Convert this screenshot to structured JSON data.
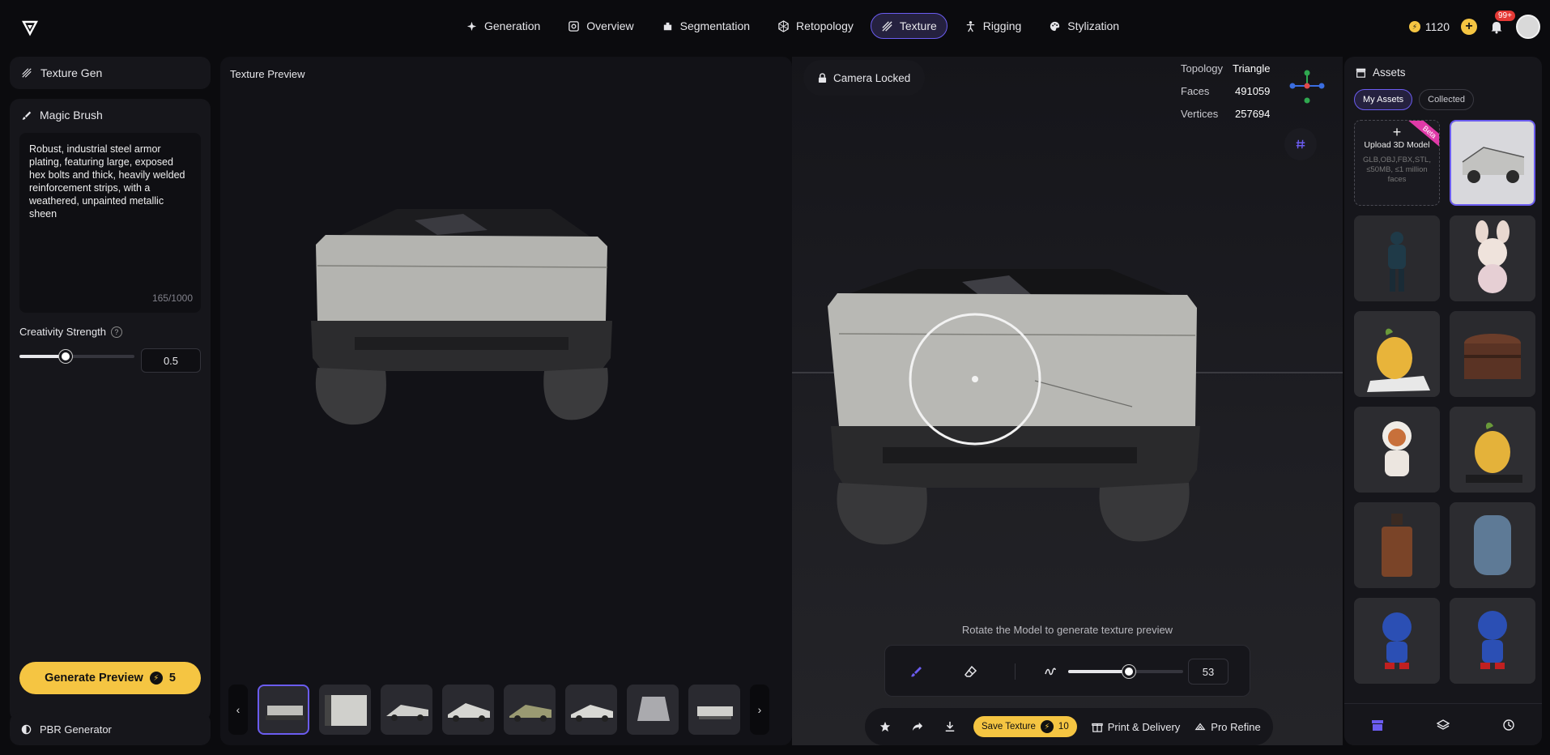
{
  "nav": {
    "items": [
      {
        "label": "Generation",
        "icon": "sparkle-icon"
      },
      {
        "label": "Overview",
        "icon": "scan-icon"
      },
      {
        "label": "Segmentation",
        "icon": "puzzle-icon"
      },
      {
        "label": "Retopology",
        "icon": "mesh-icon"
      },
      {
        "label": "Texture",
        "icon": "texture-icon",
        "active": true
      },
      {
        "label": "Rigging",
        "icon": "figure-icon"
      },
      {
        "label": "Stylization",
        "icon": "palette-icon"
      }
    ]
  },
  "account": {
    "credits": "1120",
    "notifications": "99+"
  },
  "left": {
    "title": "Texture Gen",
    "magic_brush": "Magic Brush",
    "prompt": "Robust, industrial steel armor plating, featuring large, exposed hex bolts and thick, heavily welded reinforcement strips, with a weathered, unpainted metallic sheen",
    "char_count": "165/1000",
    "strength_label": "Creativity Strength",
    "strength_value": "0.5",
    "strength_fraction": 0.5,
    "generate_label": "Generate Preview",
    "generate_cost": "5",
    "pbr_label": "PBR Generator"
  },
  "preview": {
    "title": "Texture Preview",
    "thumb_count": 8
  },
  "viewport": {
    "camera_label": "Camera Locked",
    "stats": [
      {
        "key": "Topology",
        "value": "Triangle"
      },
      {
        "key": "Faces",
        "value": "491059"
      },
      {
        "key": "Vertices",
        "value": "257694"
      }
    ],
    "rotate_hint": "Rotate the Model to generate texture preview",
    "brush_size": "53",
    "brush_fraction": 0.53
  },
  "actions": {
    "save_label": "Save Texture",
    "save_cost": "10",
    "print_label": "Print & Delivery",
    "refine_label": "Pro Refine"
  },
  "assets": {
    "title": "Assets",
    "tabs": [
      "My Assets",
      "Collected"
    ],
    "upload_title": "Upload 3D Model",
    "upload_sub": "GLB,OBJ,FBX,STL, ≤50MB, ≤1 million faces",
    "beta": "Beta",
    "items": [
      "cybertruck",
      "armored-figure",
      "bunny-creature",
      "pear-creature",
      "treasure-chest",
      "fox-astronaut",
      "pear-creature-2",
      "perfume-bottle",
      "blue-cushion",
      "sonic-figure",
      "sonic-figure-2"
    ]
  }
}
